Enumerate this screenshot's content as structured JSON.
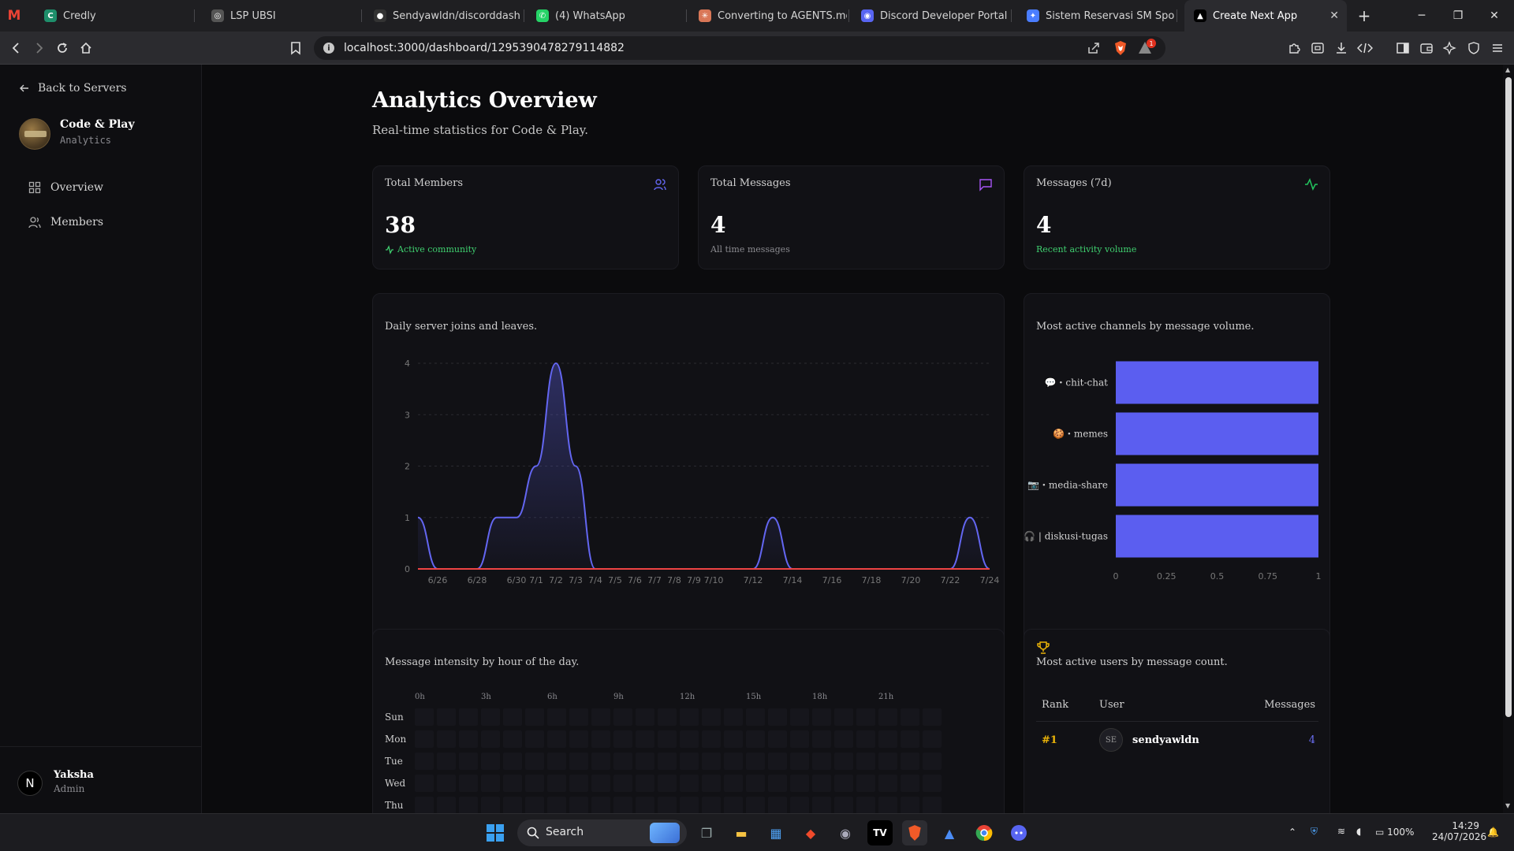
{
  "browser": {
    "tabs": [
      {
        "label": "Credly",
        "favicon": "C",
        "favicon_color": "#1e8e6b"
      },
      {
        "label": "LSP UBSI",
        "favicon": "◎",
        "favicon_color": "#555"
      },
      {
        "label": "Sendyawldn/discorddash",
        "favicon": "●",
        "favicon_color": "#333"
      },
      {
        "label": "(4) WhatsApp",
        "favicon": "✆",
        "favicon_color": "#25d366"
      },
      {
        "label": "Converting to AGENTS.md - C",
        "favicon": "✳",
        "favicon_color": "#d97757"
      },
      {
        "label": "Discord Developer Portal",
        "favicon": "◉",
        "favicon_color": "#5865f2"
      },
      {
        "label": "Sistem Reservasi SM Sport Ce",
        "favicon": "✦",
        "favicon_color": "#4a7dff"
      },
      {
        "label": "Create Next App",
        "favicon": "▲",
        "favicon_color": "#000"
      }
    ],
    "url": "localhost:3000/dashboard/1295390478279114882",
    "notification_count": "1"
  },
  "sidebar": {
    "back_label": "Back to Servers",
    "server_name": "Code & Play",
    "server_sub": "Analytics",
    "nav": [
      {
        "label": "Overview"
      },
      {
        "label": "Members"
      }
    ],
    "user": {
      "initial": "N",
      "name": "Yaksha",
      "role": "Admin"
    }
  },
  "header": {
    "title": "Analytics Overview",
    "subtitle": "Real-time statistics for Code & Play."
  },
  "stats": [
    {
      "label": "Total Members",
      "value": "38",
      "note": "Active community",
      "note_color": "#3fcf6f",
      "icon_color": "#6366f1"
    },
    {
      "label": "Total Messages",
      "value": "4",
      "note": "All time messages",
      "note_color": "#8a8a8f",
      "icon_color": "#a855f7"
    },
    {
      "label": "Messages (7d)",
      "value": "4",
      "note": "Recent activity volume",
      "note_color": "#3fcf6f",
      "icon_color": "#22c55e"
    }
  ],
  "growth": {
    "subtitle": "Daily server joins and leaves."
  },
  "channels": {
    "subtitle": "Most active channels by message volume."
  },
  "heatmap": {
    "subtitle": "Message intensity by hour of the day.",
    "hours": [
      "0h",
      "3h",
      "6h",
      "9h",
      "12h",
      "15h",
      "18h",
      "21h"
    ],
    "days": [
      "Sun",
      "Mon",
      "Tue",
      "Wed",
      "Thu"
    ]
  },
  "leaderboard": {
    "subtitle": "Most active users by message count.",
    "headers": {
      "rank": "Rank",
      "user": "User",
      "messages": "Messages"
    },
    "rows": [
      {
        "rank": "#1",
        "initials": "SE",
        "user": "sendyawldn",
        "messages": "4"
      }
    ]
  },
  "chart_data": [
    {
      "type": "area",
      "x": [
        "6/25",
        "6/26",
        "6/27",
        "6/28",
        "6/29",
        "6/30",
        "7/1",
        "7/2",
        "7/3",
        "7/4",
        "7/5",
        "7/6",
        "7/7",
        "7/8",
        "7/9",
        "7/10",
        "7/11",
        "7/12",
        "7/13",
        "7/14",
        "7/15",
        "7/16",
        "7/17",
        "7/18",
        "7/19",
        "7/20",
        "7/21",
        "7/22",
        "7/23",
        "7/24"
      ],
      "x_tick_labels": [
        "6/26",
        "6/28",
        "6/30",
        "7/1",
        "7/2",
        "7/3",
        "7/4",
        "7/5",
        "7/6",
        "7/7",
        "7/8",
        "7/9",
        "7/10",
        "7/12",
        "7/14",
        "7/16",
        "7/18",
        "7/20",
        "7/22",
        "7/24"
      ],
      "series": [
        {
          "values": [
            1,
            0,
            0,
            0,
            1,
            1,
            2,
            4,
            2,
            0,
            0,
            0,
            0,
            0,
            0,
            0,
            0,
            0,
            1,
            0,
            0,
            0,
            0,
            0,
            0,
            0,
            0,
            0,
            1,
            0
          ],
          "color": "#6366f1"
        },
        {
          "values": [
            0,
            0,
            0,
            0,
            0,
            0,
            0,
            0,
            0,
            0,
            0,
            0,
            0,
            0,
            0,
            0,
            0,
            0,
            0,
            0,
            0,
            0,
            0,
            0,
            0,
            0,
            0,
            0,
            0,
            0
          ],
          "color": "#ef4444"
        }
      ],
      "ylim": [
        0,
        4
      ],
      "yticks": [
        0,
        1,
        2,
        3,
        4
      ],
      "grid": true
    },
    {
      "type": "bar",
      "orientation": "horizontal",
      "categories": [
        "💬・chit-chat",
        "🍪・memes",
        "📷・media-share",
        "🎧 | diskusi-tugas"
      ],
      "values": [
        1,
        1,
        1,
        1
      ],
      "xlim": [
        0,
        1
      ],
      "xticks": [
        "0",
        "0.25",
        "0.5",
        "0.75",
        "1"
      ],
      "color": "#5b5ef0"
    }
  ]
}
